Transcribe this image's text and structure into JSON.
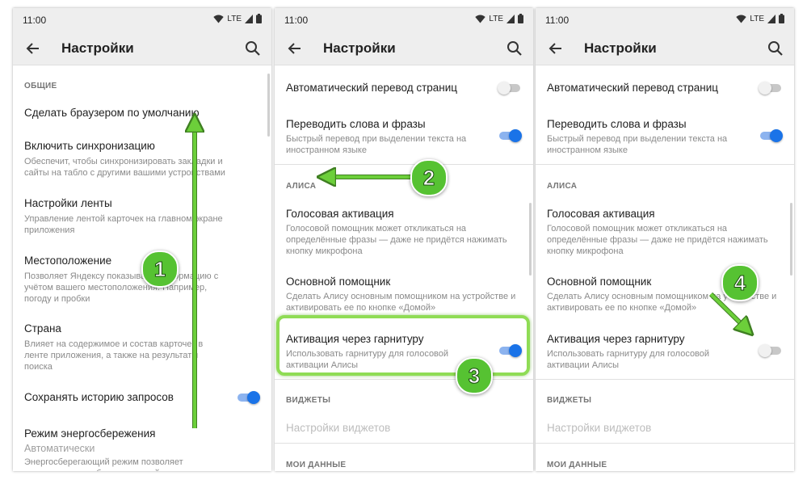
{
  "status": {
    "time": "11:00",
    "network": "LTE"
  },
  "header": {
    "title": "Настройки"
  },
  "phone1": {
    "section_general": "ОБЩИЕ",
    "items": [
      {
        "title": "Сделать браузером по умолчанию"
      },
      {
        "title": "Включить синхронизацию",
        "subtitle": "Обеспечит, чтобы синхронизировать закладки и сайты на табло с другими вашими устройствами"
      },
      {
        "title": "Настройки ленты",
        "subtitle": "Управление лентой карточек на главном экране приложения"
      },
      {
        "title": "Местоположение",
        "subtitle": "Позволяет Яндексу показывать информацию с учётом вашего местоположения. Например, погоду и пробки"
      },
      {
        "title": "Страна",
        "subtitle": "Влияет на содержимое и состав карточек в ленте приложения, а также на результаты поиска"
      },
      {
        "title": "Сохранять историю запросов",
        "toggle": true
      },
      {
        "title": "Режим энергосбережения",
        "value": "Автоматически",
        "subtitle": "Энергосберегающий режим позволяет экономить заряд батареи устройства"
      }
    ]
  },
  "phone2": {
    "auto_translate": "Автоматический перевод страниц",
    "translate_words": "Переводить слова и фразы",
    "translate_words_sub": "Быстрый перевод при выделении текста на иностранном языке",
    "section_alice": "АЛИСА",
    "voice_activation": "Голосовая активация",
    "voice_activation_sub": "Голосовой помощник может откликаться на определённые фразы — даже не придётся нажимать кнопку микрофона",
    "main_assistant": "Основной помощник",
    "main_assistant_sub": "Сделать Алису основным помощником на устройстве и активировать ее по кнопке «Домой»",
    "headset": "Активация через гарнитуру",
    "headset_sub": "Использовать гарнитуру для голосовой активации Алисы",
    "section_widgets": "ВИДЖЕТЫ",
    "widget_settings": "Настройки виджетов",
    "section_mydata": "МОИ ДАННЫЕ",
    "toggles": {
      "auto_translate": false,
      "translate_words": true,
      "headset": true
    }
  },
  "phone3": {
    "toggles": {
      "auto_translate": false,
      "translate_words": true,
      "headset": false
    }
  },
  "steps": [
    "1",
    "2",
    "3",
    "4"
  ],
  "colors": {
    "accent": "#1a73e8",
    "badge": "#56c232",
    "arrow": "#6ccf3a"
  }
}
